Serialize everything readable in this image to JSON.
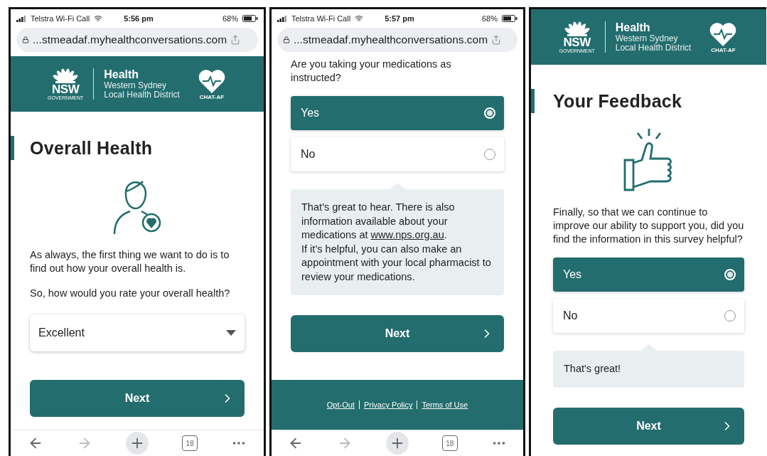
{
  "phones": [
    {
      "status_bar": {
        "carrier": "Telstra Wi-Fi Call",
        "time": "5:56 pm",
        "battery": "68%"
      },
      "url": "...stmeadaf.myhealthconversations.com",
      "header": {
        "nsw": "NSW",
        "government": "GOVERNMENT",
        "health": "Health",
        "district_1": "Western Sydney",
        "district_2": "Local Health District",
        "chat": "CHAT-AF"
      },
      "blocks": [
        {
          "kind": "heading",
          "text": "Overall Health"
        },
        {
          "kind": "avatar"
        },
        {
          "kind": "text",
          "text": "As always, the first thing we want to do is to find out how your overall health is."
        },
        {
          "kind": "text",
          "text": "So, how would you rate your overall health?"
        },
        {
          "kind": "select",
          "value": "Excellent"
        },
        {
          "kind": "button",
          "text": "Next"
        }
      ],
      "toolbar": {
        "tabs": "18"
      }
    },
    {
      "status_bar": {
        "carrier": "Telstra Wi-Fi Call",
        "time": "5:57 pm",
        "battery": "68%"
      },
      "url": "...stmeadaf.myhealthconversations.com",
      "blocks": [
        {
          "kind": "text",
          "text": "Are you taking your medications as instructed?"
        },
        {
          "kind": "options",
          "options": [
            {
              "label": "Yes",
              "selected": true
            },
            {
              "label": "No",
              "selected": false
            }
          ]
        },
        {
          "kind": "bubble",
          "text": "That’s great to hear. There is also information available about your medications at ",
          "link": "www.nps.org.au",
          "after": ".",
          "text_2": "If it’s helpful, you can also make an appointment with your local pharmacist to review your medications."
        },
        {
          "kind": "button",
          "text": "Next"
        }
      ],
      "footer": [
        "Opt-Out",
        "Privacy Policy",
        "Terms of Use"
      ],
      "toolbar": {
        "tabs": "18"
      }
    },
    {
      "header": {
        "nsw": "NSW",
        "government": "GOVERNMENT",
        "health": "Health",
        "district_1": "Western Sydney",
        "district_2": "Local Health District",
        "chat": "CHAT-AF"
      },
      "blocks": [
        {
          "kind": "heading",
          "text": "Your Feedback"
        },
        {
          "kind": "thumbsup"
        },
        {
          "kind": "text",
          "text": "Finally, so that we can continue to improve our ability to support you, did you find the information in this survey helpful?"
        },
        {
          "kind": "options",
          "options": [
            {
              "label": "Yes",
              "selected": true
            },
            {
              "label": "No",
              "selected": false
            }
          ]
        },
        {
          "kind": "bubble",
          "text": "That's great!"
        },
        {
          "kind": "button",
          "text": "Next"
        }
      ]
    }
  ]
}
